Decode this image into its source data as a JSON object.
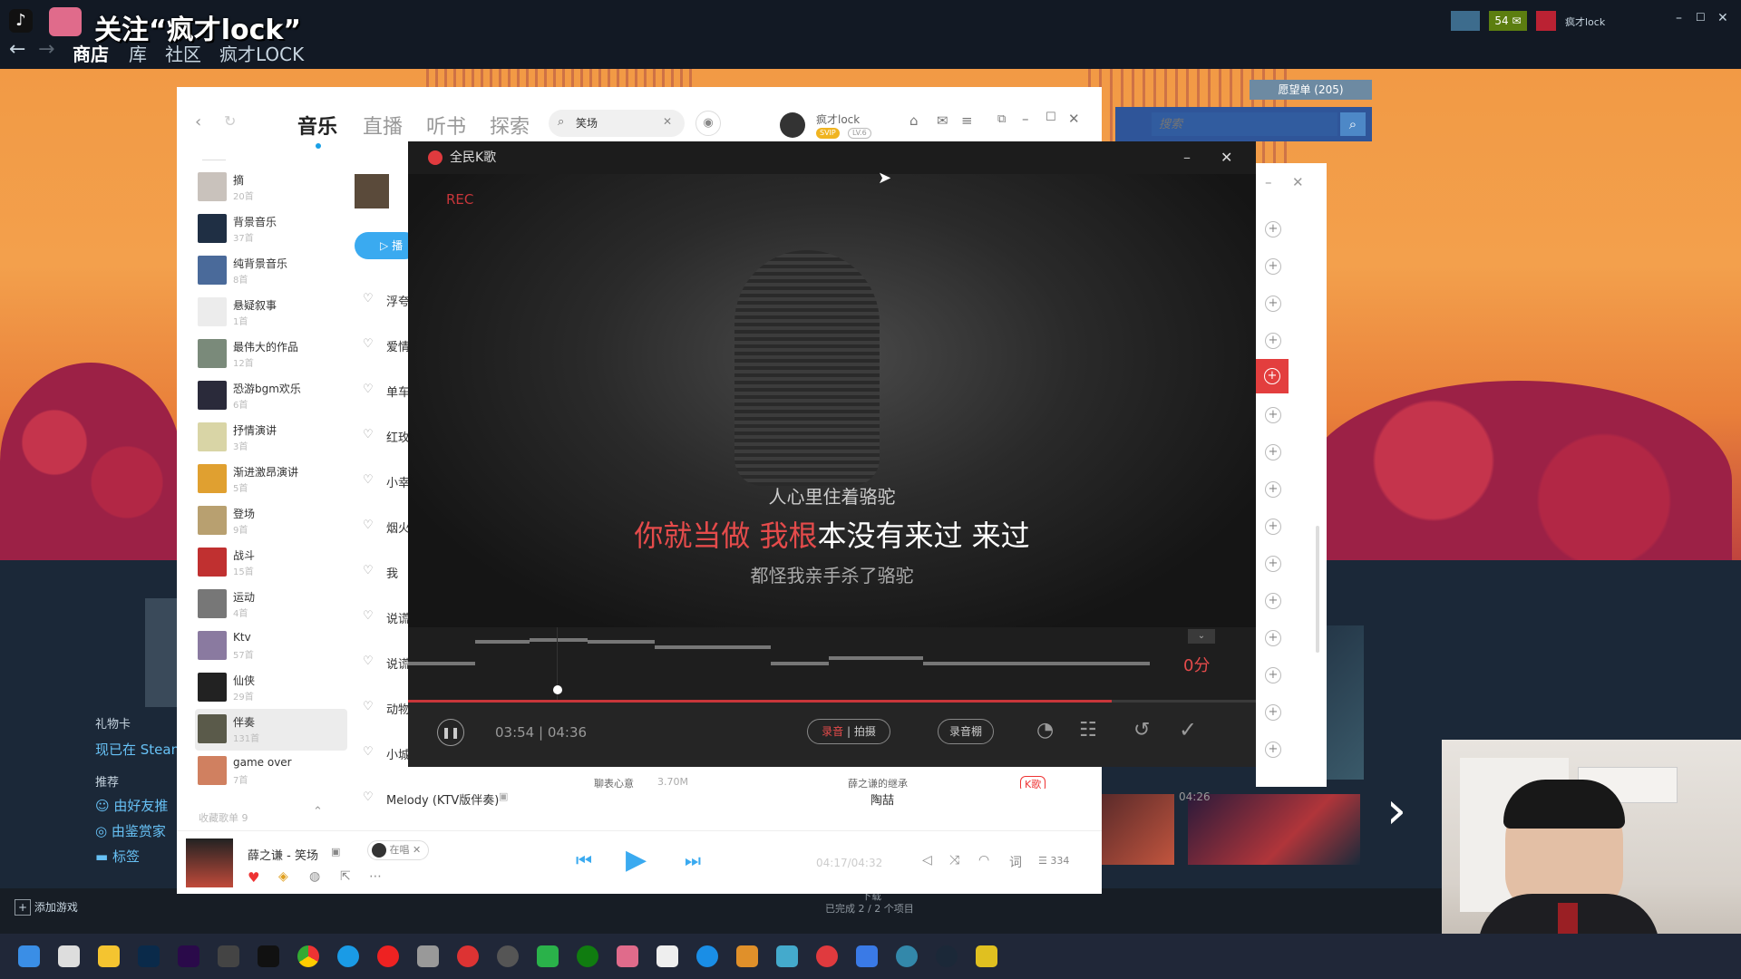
{
  "steam": {
    "stream_title": "关注“疯才lock”",
    "nav": [
      "商店",
      "库",
      "社区",
      "疯才LOCK"
    ],
    "notif_count": "54",
    "user_name": "疯才lock",
    "wishlist": "愿望单 (205)",
    "search_placeholder": "搜索",
    "sidebar_gift": "礼物卡",
    "sidebar_now": "现已在 Steam",
    "sidebar_recommend": "推荐",
    "sidebar_links": [
      "由好友推",
      "由鉴赏家",
      "标签"
    ],
    "add_game": "添加游戏",
    "downloads_label": "下载",
    "downloads_status": "已完成 2 / 2 个项目"
  },
  "music": {
    "tabs": [
      "音乐",
      "直播",
      "听书",
      "探索"
    ],
    "search_value": "笑场",
    "user_name": "疯才lock",
    "badge_svip": "SVIP",
    "badge_level": "LV.6",
    "sidebar_items": [
      {
        "name": "摘",
        "count": "20首"
      },
      {
        "name": "背景音乐",
        "count": "37首"
      },
      {
        "name": "纯背景音乐",
        "count": "8首"
      },
      {
        "name": "悬疑叙事",
        "count": "1首"
      },
      {
        "name": "最伟大的作品",
        "count": "12首"
      },
      {
        "name": "恐游bgm欢乐",
        "count": "6首"
      },
      {
        "name": "抒情演讲",
        "count": "3首"
      },
      {
        "name": "渐进激昂演讲",
        "count": "5首"
      },
      {
        "name": "登场",
        "count": "9首"
      },
      {
        "name": "战斗",
        "count": "15首"
      },
      {
        "name": "运动",
        "count": "4首"
      },
      {
        "name": "Ktv",
        "count": "57首"
      },
      {
        "name": "仙侠",
        "count": "29首"
      },
      {
        "name": "伴奏",
        "count": "131首"
      },
      {
        "name": "game over",
        "count": "7首"
      }
    ],
    "collected_label": "收藏歌单 9",
    "song_rows": [
      "浮夸",
      "爱情",
      "单车",
      "红玫",
      "小幸",
      "烟火",
      "我",
      "说谎",
      "说谎",
      "动物",
      "小城"
    ],
    "last_song": {
      "title": "Melody (KTV版伴奏)",
      "artist": "陶喆",
      "duration": "04:26"
    },
    "partial_row": {
      "title": "聊表心意",
      "size": "3.70M",
      "album": "薛之谦的继承",
      "tag": "K歌"
    },
    "play_label": "播"
  },
  "kge": {
    "title": "全民K歌",
    "rec": "REC",
    "lyric_prev": "人心里住着骆驼",
    "lyric_current_sung": "你就当做 我根",
    "lyric_current_rest": "本没有来过 来过",
    "lyric_next": "都怪我亲手杀了骆驼",
    "score": "0分",
    "time_current": "03:54",
    "time_total": "04:36",
    "progress": 0.83,
    "record_label": "录音",
    "shoot_label": "拍摄",
    "studio_label": "录音棚",
    "colors": {
      "accent": "#e03a3e",
      "lyric_done": "#e54b4b"
    }
  },
  "player": {
    "song": "薛之谦 - 笑场",
    "singing_label": "在唱",
    "time": "04:17/04:32",
    "progress": 0.94,
    "lyric_btn": "词",
    "playlist_count": "334"
  }
}
